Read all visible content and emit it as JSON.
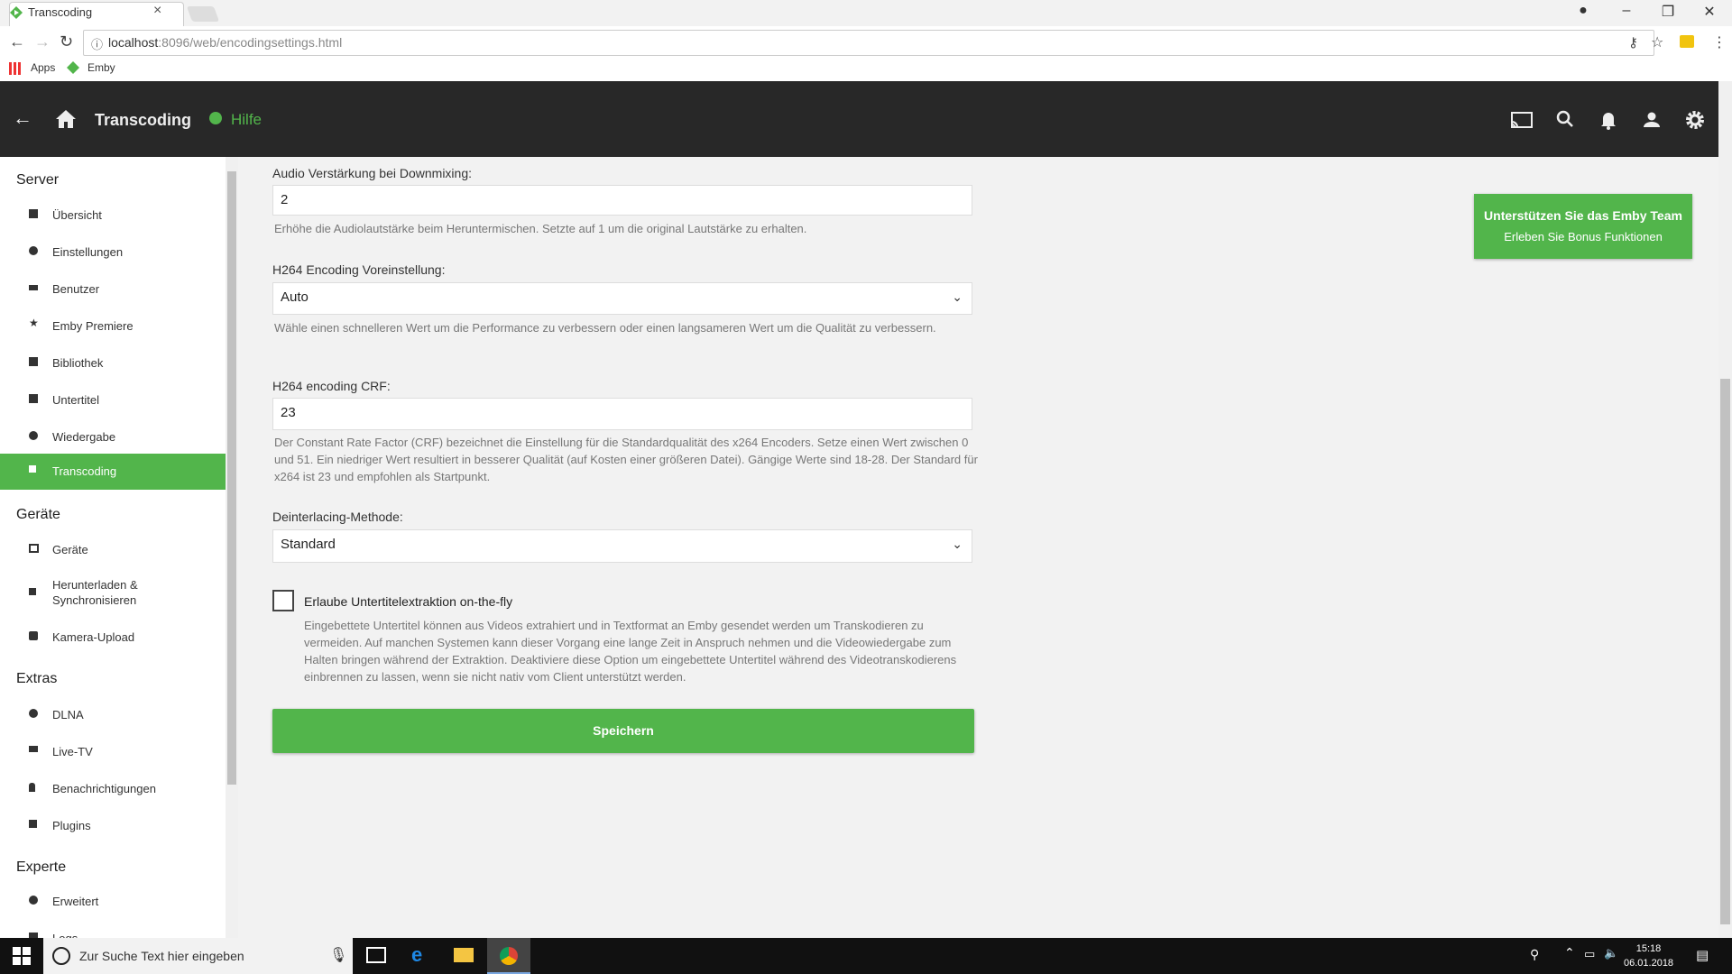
{
  "browser": {
    "tab_title": "Transcoding",
    "url_host": "localhost",
    "url_rest": ":8096/web/encodingsettings.html",
    "bookmarks": [
      "Apps",
      "Emby"
    ]
  },
  "header": {
    "title": "Transcoding",
    "help": "Hilfe"
  },
  "sidebar": {
    "sections": [
      {
        "title": "Server",
        "items": [
          "Übersicht",
          "Einstellungen",
          "Benutzer",
          "Emby Premiere",
          "Bibliothek",
          "Untertitel",
          "Wiedergabe",
          "Transcoding"
        ]
      },
      {
        "title": "Geräte",
        "items": [
          "Geräte",
          "Herunterladen & Synchronisieren",
          "Kamera-Upload"
        ]
      },
      {
        "title": "Extras",
        "items": [
          "DLNA",
          "Live-TV",
          "Benachrichtigungen",
          "Plugins"
        ]
      },
      {
        "title": "Experte",
        "items": [
          "Erweitert",
          "Logs"
        ]
      }
    ],
    "active": "Transcoding"
  },
  "form": {
    "audio_boost": {
      "label": "Audio Verstärkung bei Downmixing:",
      "value": "2",
      "help": "Erhöhe die Audiolautstärke beim Heruntermischen. Setzte auf 1 um die original Lautstärke zu erhalten."
    },
    "h264_preset": {
      "label": "H264 Encoding Voreinstellung:",
      "value": "Auto",
      "help": "Wähle einen schnelleren Wert um die Performance zu verbessern oder einen langsameren Wert um die Qualität zu verbessern."
    },
    "h264_crf": {
      "label": "H264 encoding CRF:",
      "value": "23",
      "help": "Der Constant Rate Factor (CRF) bezeichnet die Einstellung für die Standardqualität des x264 Encoders. Setze einen Wert zwischen 0 und 51. Ein niedriger Wert resultiert in besserer Qualität (auf Kosten einer größeren Datei). Gängige Werte sind 18-28. Der Standard für x264 ist 23 und empfohlen als Startpunkt."
    },
    "deinterlace": {
      "label": "Deinterlacing-Methode:",
      "value": "Standard"
    },
    "subtitle_extract": {
      "label": "Erlaube Untertitelextraktion on-the-fly",
      "checked": false,
      "help": "Eingebettete Untertitel können aus Videos extrahiert und in Textformat an Emby gesendet werden um Transkodieren zu vermeiden. Auf manchen Systemen kann dieser Vorgang eine lange Zeit in Anspruch nehmen und die Videowiedergabe zum Halten bringen während der Extraktion. Deaktiviere diese Option um eingebettete Untertitel während des Videotranskodierens einbrennen zu lassen, wenn sie nicht nativ vom Client unterstützt werden."
    },
    "save": "Speichern"
  },
  "support": {
    "title": "Unterstützen Sie das Emby Team",
    "subtitle": "Erleben Sie Bonus Funktionen"
  },
  "taskbar": {
    "search_placeholder": "Zur Suche Text hier eingeben",
    "time": "15:18",
    "date": "06.01.2018"
  },
  "colors": {
    "accent": "#52b54b",
    "header": "#282828"
  }
}
